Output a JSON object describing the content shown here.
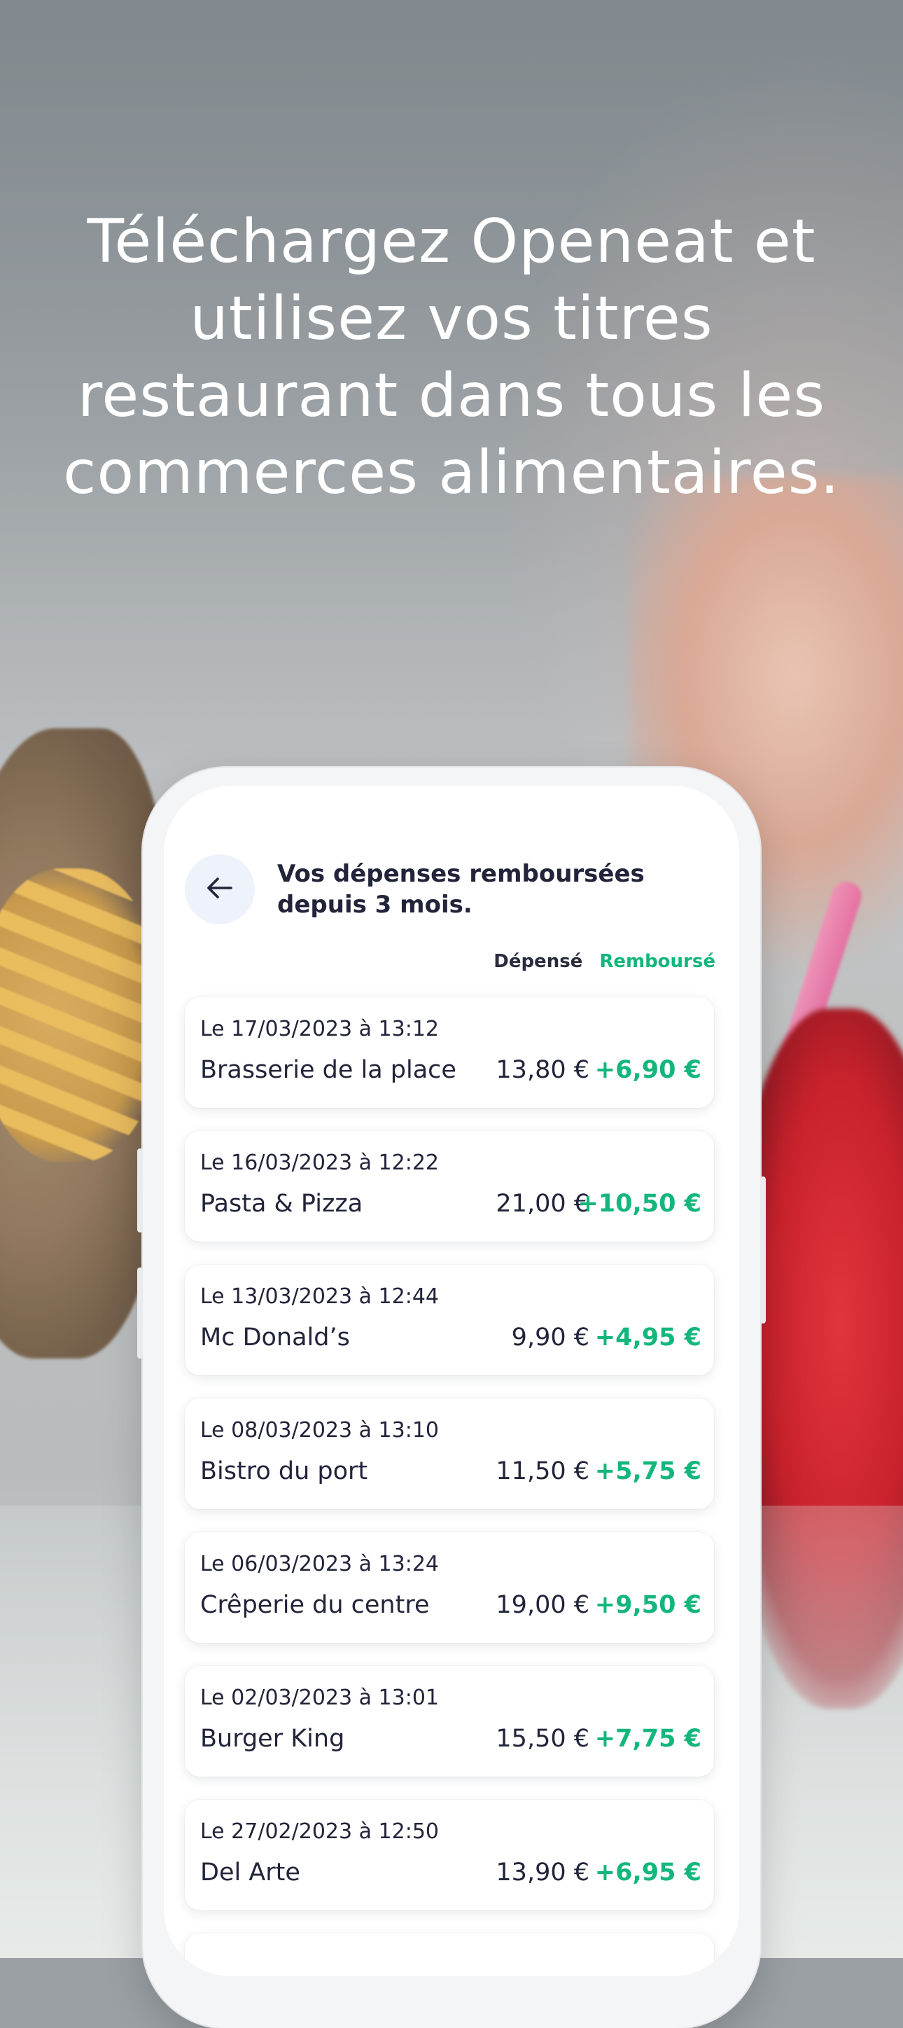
{
  "headline": "Téléchargez Openeat et utilisez vos titres restaurant dans tous les commerces alimentaires.",
  "screen": {
    "title": "Vos dépenses remboursées depuis 3 mois.",
    "columns": {
      "spent": "Dépensé",
      "refunded": "Remboursé"
    },
    "transactions": [
      {
        "date": "Le 17/03/2023 à 13:12",
        "name": "Brasserie de la place",
        "spent": "13,80 €",
        "refunded": "+6,90 €"
      },
      {
        "date": "Le 16/03/2023 à 12:22",
        "name": "Pasta & Pizza",
        "spent": "21,00 €",
        "refunded": "+10,50 €"
      },
      {
        "date": "Le 13/03/2023 à 12:44",
        "name": "Mc Donald’s",
        "spent": "9,90 €",
        "refunded": "+4,95 €"
      },
      {
        "date": "Le 08/03/2023 à 13:10",
        "name": "Bistro du port",
        "spent": "11,50 €",
        "refunded": "+5,75 €"
      },
      {
        "date": "Le 06/03/2023 à 13:24",
        "name": "Crêperie du centre",
        "spent": "19,00 €",
        "refunded": "+9,50 €"
      },
      {
        "date": "Le 02/03/2023 à 13:01",
        "name": "Burger King",
        "spent": "15,50 €",
        "refunded": "+7,75 €"
      },
      {
        "date": "Le 27/02/2023 à 12:50",
        "name": "Del Arte",
        "spent": "13,90 €",
        "refunded": "+6,95 €"
      }
    ]
  },
  "icons": {
    "back": "arrow-left-icon"
  },
  "colors": {
    "accent_green": "#13b67b",
    "text_dark": "#22243a",
    "back_button_bg": "#eef2fb"
  }
}
